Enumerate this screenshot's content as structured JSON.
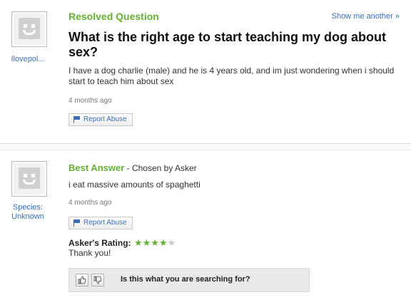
{
  "question": {
    "header": "Resolved Question",
    "show_another": "Show me another »",
    "title": "What is the right age to start teaching my dog about sex?",
    "details": "I have a dog charlie (male) and he is 4 years old, and im just wondering when i should start to teach him about sex",
    "time": "4 months ago",
    "report_label": "Report Abuse",
    "asker_name": "Ilovepol..."
  },
  "answer": {
    "header": "Best Answer",
    "chosen_by": "- Chosen by Asker",
    "text": "i eat massive amounts of spaghetti",
    "time": "4 months ago",
    "report_label": "Report Abuse",
    "answerer_name_line1": "Species:",
    "answerer_name_line2": "Unknown",
    "rating_label": "Asker's Rating:",
    "rating_value": 4,
    "rating_max": 5,
    "rating_stars_on": "★★★★",
    "rating_stars_off": "★",
    "comment": "Thank you!"
  },
  "feedback": {
    "prompt": "Is this what you are searching for?",
    "thumb_up_icon": "thumbs-up-icon",
    "thumb_down_icon": "thumbs-down-icon"
  },
  "colors": {
    "accent_green": "#63b132",
    "link_blue": "#3a6fb5"
  }
}
